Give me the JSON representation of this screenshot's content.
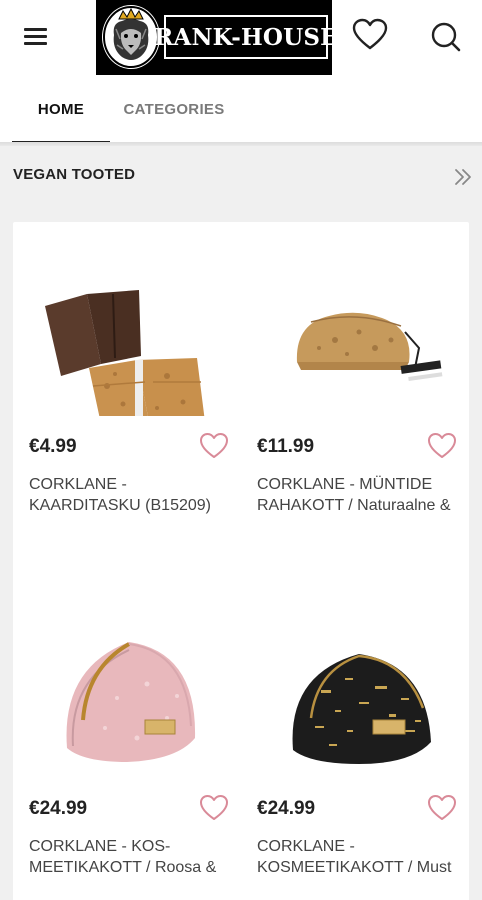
{
  "header": {
    "logo_text": "RANK-HOUSE",
    "menu_icon": "hamburger-menu-icon",
    "wishlist_icon": "heart-icon",
    "search_icon": "search-icon"
  },
  "tabs": [
    {
      "label": "HOME",
      "active": true
    },
    {
      "label": "CATEGORIES",
      "active": false
    }
  ],
  "section": {
    "title": "VEGAN TOOTED",
    "more_icon": "double-chevron-right-icon"
  },
  "products": [
    {
      "price": "€4.99",
      "name": "CORKLANE - KAARDITASKU (B15209)",
      "image": "cork-card-wallet"
    },
    {
      "price": "€11.99",
      "name": "CORKLANE - MÜNTIDE RAHAKOTT / Naturaalne &",
      "image": "cork-coin-purse"
    },
    {
      "price": "€24.99",
      "name": "CORKLANE - KOS-MEETIKAKOTT / Roosa &",
      "image": "pink-cosmetic-bag"
    },
    {
      "price": "€24.99",
      "name": "CORKLANE - KOSMEETIKAKOTT / Must",
      "image": "black-cosmetic-bag"
    }
  ],
  "colors": {
    "background": "#f0f0f0",
    "favorite_heart": "#d98a98",
    "text_primary": "#222222",
    "tab_inactive": "#7a7a7a"
  }
}
